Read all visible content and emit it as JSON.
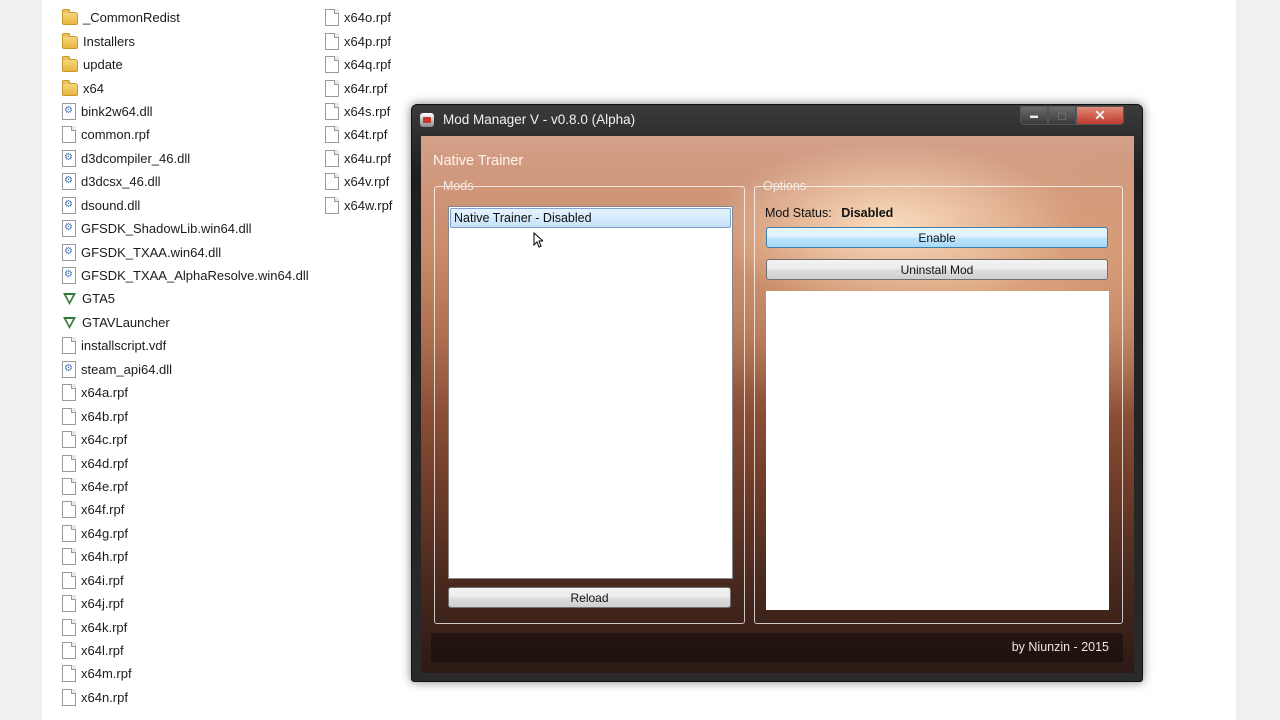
{
  "explorer": {
    "column1": [
      {
        "name": "_CommonRedist",
        "icon": "folder-icon"
      },
      {
        "name": "Installers",
        "icon": "folder-icon"
      },
      {
        "name": "update",
        "icon": "folder-icon"
      },
      {
        "name": "x64",
        "icon": "folder-icon"
      },
      {
        "name": "bink2w64.dll",
        "icon": "dll-icon"
      },
      {
        "name": "common.rpf",
        "icon": "file-icon"
      },
      {
        "name": "d3dcompiler_46.dll",
        "icon": "dll-icon"
      },
      {
        "name": "d3dcsx_46.dll",
        "icon": "dll-icon"
      },
      {
        "name": "dsound.dll",
        "icon": "dll-icon"
      },
      {
        "name": "GFSDK_ShadowLib.win64.dll",
        "icon": "dll-icon"
      },
      {
        "name": "GFSDK_TXAA.win64.dll",
        "icon": "dll-icon"
      },
      {
        "name": "GFSDK_TXAA_AlphaResolve.win64.dll",
        "icon": "dll-icon"
      },
      {
        "name": "GTA5",
        "icon": "gta-v-icon"
      },
      {
        "name": "GTAVLauncher",
        "icon": "gta-v-icon"
      },
      {
        "name": "installscript.vdf",
        "icon": "file-icon"
      },
      {
        "name": "steam_api64.dll",
        "icon": "dll-icon"
      },
      {
        "name": "x64a.rpf",
        "icon": "file-icon"
      },
      {
        "name": "x64b.rpf",
        "icon": "file-icon"
      },
      {
        "name": "x64c.rpf",
        "icon": "file-icon"
      },
      {
        "name": "x64d.rpf",
        "icon": "file-icon"
      },
      {
        "name": "x64e.rpf",
        "icon": "file-icon"
      },
      {
        "name": "x64f.rpf",
        "icon": "file-icon"
      },
      {
        "name": "x64g.rpf",
        "icon": "file-icon"
      },
      {
        "name": "x64h.rpf",
        "icon": "file-icon"
      },
      {
        "name": "x64i.rpf",
        "icon": "file-icon"
      },
      {
        "name": "x64j.rpf",
        "icon": "file-icon"
      },
      {
        "name": "x64k.rpf",
        "icon": "file-icon"
      },
      {
        "name": "x64l.rpf",
        "icon": "file-icon"
      },
      {
        "name": "x64m.rpf",
        "icon": "file-icon"
      },
      {
        "name": "x64n.rpf",
        "icon": "file-icon"
      }
    ],
    "column2": [
      {
        "name": "x64o.rpf",
        "icon": "file-icon"
      },
      {
        "name": "x64p.rpf",
        "icon": "file-icon"
      },
      {
        "name": "x64q.rpf",
        "icon": "file-icon"
      },
      {
        "name": "x64r.rpf",
        "icon": "file-icon"
      },
      {
        "name": "x64s.rpf",
        "icon": "file-icon"
      },
      {
        "name": "x64t.rpf",
        "icon": "file-icon"
      },
      {
        "name": "x64u.rpf",
        "icon": "file-icon"
      },
      {
        "name": "x64v.rpf",
        "icon": "file-icon"
      },
      {
        "name": "x64w.rpf",
        "icon": "file-icon"
      }
    ]
  },
  "window": {
    "title": "Mod Manager V - v0.8.0 (Alpha)",
    "close_glyph": "✕",
    "minimize_glyph": "▬",
    "maximize_glyph": "□"
  },
  "mod_manager": {
    "selected_mod_title": "Native Trainer",
    "mods_group_label": "Mods",
    "mods_list": [
      "Native Trainer - Disabled"
    ],
    "reload_label": "Reload",
    "options_group_label": "Options",
    "status_label": "Mod Status:",
    "status_value": "Disabled",
    "enable_label": "Enable",
    "uninstall_label": "Uninstall Mod",
    "footer": "by Niunzin - 2015"
  },
  "colors": {
    "accent_button": "#a7d9f5",
    "selection": "#c6e2f8",
    "close_button": "#c0392b"
  }
}
